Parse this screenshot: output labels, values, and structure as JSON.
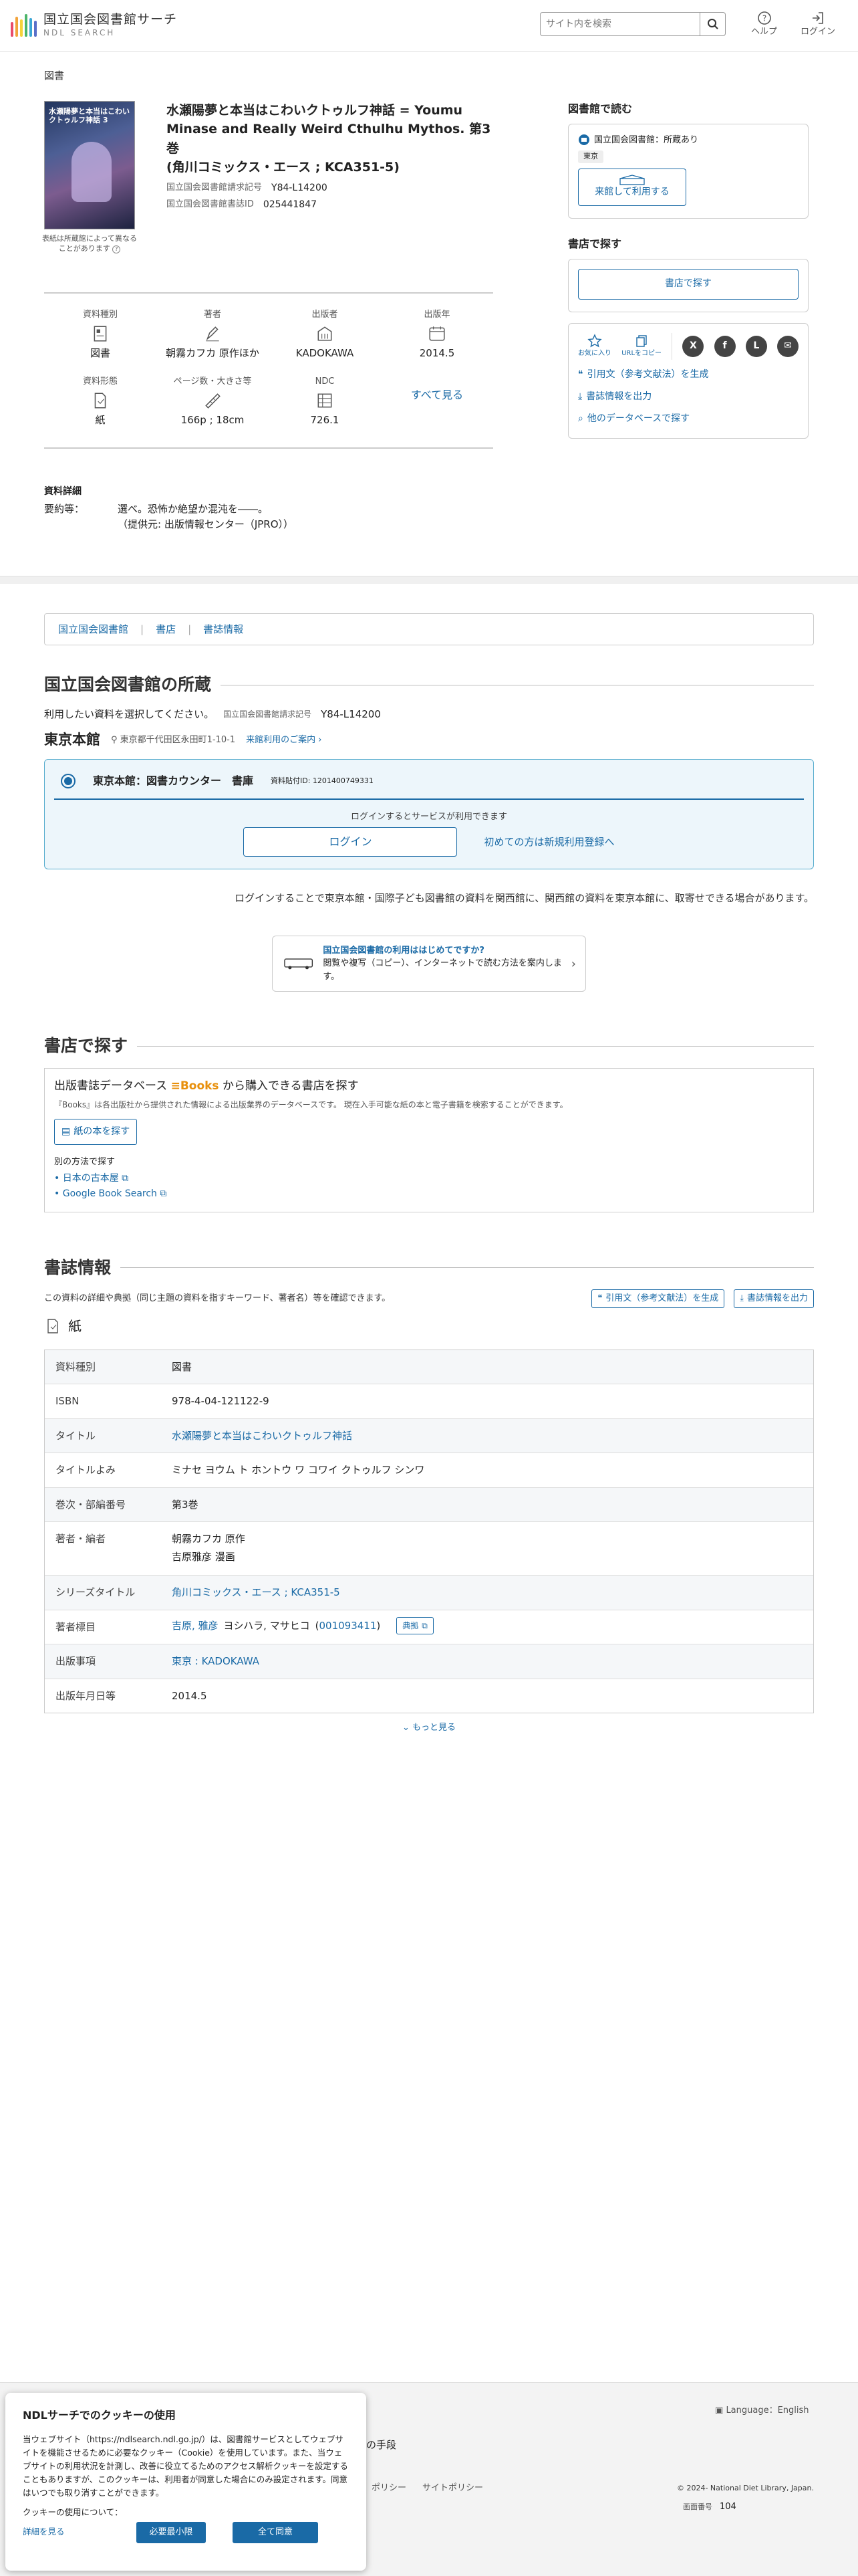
{
  "header": {
    "logo_title": "国立国会図書館サーチ",
    "logo_sub": "NDL SEARCH",
    "search_placeholder": "サイト内を検索",
    "help": "ヘルプ",
    "login": "ログイン"
  },
  "breadcrumb": "図書",
  "book": {
    "title": "水瀬陽夢と本当はこわいクトゥルフ神話 = Youmu Minase and Really Weird Cthulhu Mythos. 第3巻",
    "series_line": "(角川コミックス・エース ; KCA351-5)",
    "call_label": "国立国会図書館請求記号",
    "call_value": "Y84-L14200",
    "id_label": "国立国会図書館書誌ID",
    "id_value": "025441847",
    "cover_note": "表紙は所蔵館によって異なることがあります",
    "cover_text": "水瀬陽夢と本当はこわいクトゥルフ神話 3"
  },
  "facts": [
    {
      "k": "資料種別",
      "v": "図書",
      "icon": "book-type-icon"
    },
    {
      "k": "著者",
      "v": "朝霧カフカ 原作ほか",
      "icon": "pen-icon"
    },
    {
      "k": "出版者",
      "v": "KADOKAWA",
      "icon": "building-icon"
    },
    {
      "k": "出版年",
      "v": "2014.5",
      "icon": "calendar-icon"
    },
    {
      "k": "資料形態",
      "v": "紙",
      "icon": "paper-icon"
    },
    {
      "k": "ページ数・大きさ等",
      "v": "166p ; 18cm",
      "icon": "ruler-icon"
    },
    {
      "k": "NDC",
      "v": "726.1",
      "icon": "ndc-icon"
    }
  ],
  "see_all": "すべて見る",
  "detail": {
    "heading": "資料詳細",
    "summary_label": "要約等：",
    "summary_1": "選べ。恐怖か絶望か混沌を――。",
    "summary_2": "（提供元: 出版情報センター（JPRO））"
  },
  "side": {
    "read_heading": "図書館で読む",
    "ndl_holding": "国立国会図書館：所蔵あり",
    "tokyo_tag": "東京",
    "visit_btn": "来館して利用する",
    "store_heading": "書店で探す",
    "store_btn": "書店で探す",
    "fav": "お気に入り",
    "copy_url": "URLをコピー",
    "cite": "引用文（参考文献法）を生成",
    "export": "書誌情報を出力",
    "other_db": "他のデータベースで探す"
  },
  "tabs": [
    "国立国会図書館",
    "書店",
    "書誌情報"
  ],
  "holdings": {
    "heading": "国立国会図書館の所蔵",
    "select_text": "利用したい資料を選択してください。",
    "call_label": "国立国会図書館請求記号",
    "call_value": "Y84-L14200",
    "branch": "東京本館",
    "address": "東京都千代田区永田町1-10-1",
    "visit_guide": "来館利用のご案内",
    "counter": "東京本館：図書カウンター　書庫",
    "item_id": "資料貼付ID: 1201400749331",
    "login_note": "ログインするとサービスが利用できます",
    "login_btn": "ログイン",
    "register": "初めての方は新規利用登録へ",
    "transfer_note": "ログインすることで東京本館・国際子ども図書館の資料を関西館に、関西館の資料を東京本館に、取寄せできる場合があります。",
    "guide_title": "国立国会図書館の利用ははじめてですか?",
    "guide_text": "閲覧や複写（コピー）、インターネットで読む方法を案内します。"
  },
  "store": {
    "heading": "書店で探す",
    "db_label": "出版書誌データベース",
    "brand": "Books",
    "db_suffix": "から購入できる書店を探す",
    "desc": "『Books』は各出版社から提供された情報による出版業界のデータベースです。 現在入手可能な紙の本と電子書籍を検索することができます。",
    "paper_btn": "紙の本を探す",
    "other_label": "別の方法で探す",
    "links": [
      "日本の古本屋",
      "Google Book Search"
    ]
  },
  "biblio": {
    "heading": "書誌情報",
    "desc": "この資料の詳細や典拠（同じ主題の資料を指すキーワード、著者名）等を確認できます。",
    "cite_btn": "引用文（参考文献法）を生成",
    "export_btn": "書誌情報を出力",
    "format": "紙",
    "rows": [
      {
        "k": "資料種別",
        "v": "図書"
      },
      {
        "k": "ISBN",
        "v": "978-4-04-121122-9"
      },
      {
        "k": "タイトル",
        "v": "水瀬陽夢と本当はこわいクトゥルフ神話"
      },
      {
        "k": "タイトルよみ",
        "v": "ミナセ ヨウム ト ホントウ ワ コワイ クトゥルフ シンワ"
      },
      {
        "k": "巻次・部編番号",
        "v": "第3巻"
      },
      {
        "k": "著者・編者",
        "v": "朝霧カフカ 原作",
        "v2": "吉原雅彦 漫画"
      },
      {
        "k": "シリーズタイトル",
        "v": "角川コミックス・エース ; KCA351-5"
      },
      {
        "k": "著者標目",
        "v": "吉原, 雅彦",
        "v2": "ヨシハラ, マサヒコ",
        "v3": "001093411",
        "btn": "典拠"
      },
      {
        "k": "出版事項",
        "v": "東京 : KADOKAWA"
      },
      {
        "k": "出版年月日等",
        "v": "2014.5"
      }
    ],
    "more": "もっと見る"
  },
  "footer": {
    "language": "Language：English",
    "means": "の手段",
    "policy": "ポリシー",
    "site_policy": "サイトポリシー",
    "copyright": "© 2024- National Diet Library, Japan.",
    "screen_label": "画面番号",
    "screen_no": "104"
  },
  "cookie": {
    "title": "NDLサーチでのクッキーの使用",
    "body": "当ウェブサイト（https://ndlsearch.ndl.go.jp/）は、図書館サービスとしてウェブサイトを機能させるために必要なクッキー（Cookie）を使用しています。また、当ウェブサイトの利用状況を計測し、改善に役立てるためのアクセス解析クッキーを設定することもありますが、このクッキーは、利用者が同意した場合にのみ設定されます。同意はいつでも取り消すことができます。",
    "about": "クッキーの使用について：",
    "details": "詳細を見る",
    "necessary": "必要最小限",
    "accept": "全て同意"
  }
}
